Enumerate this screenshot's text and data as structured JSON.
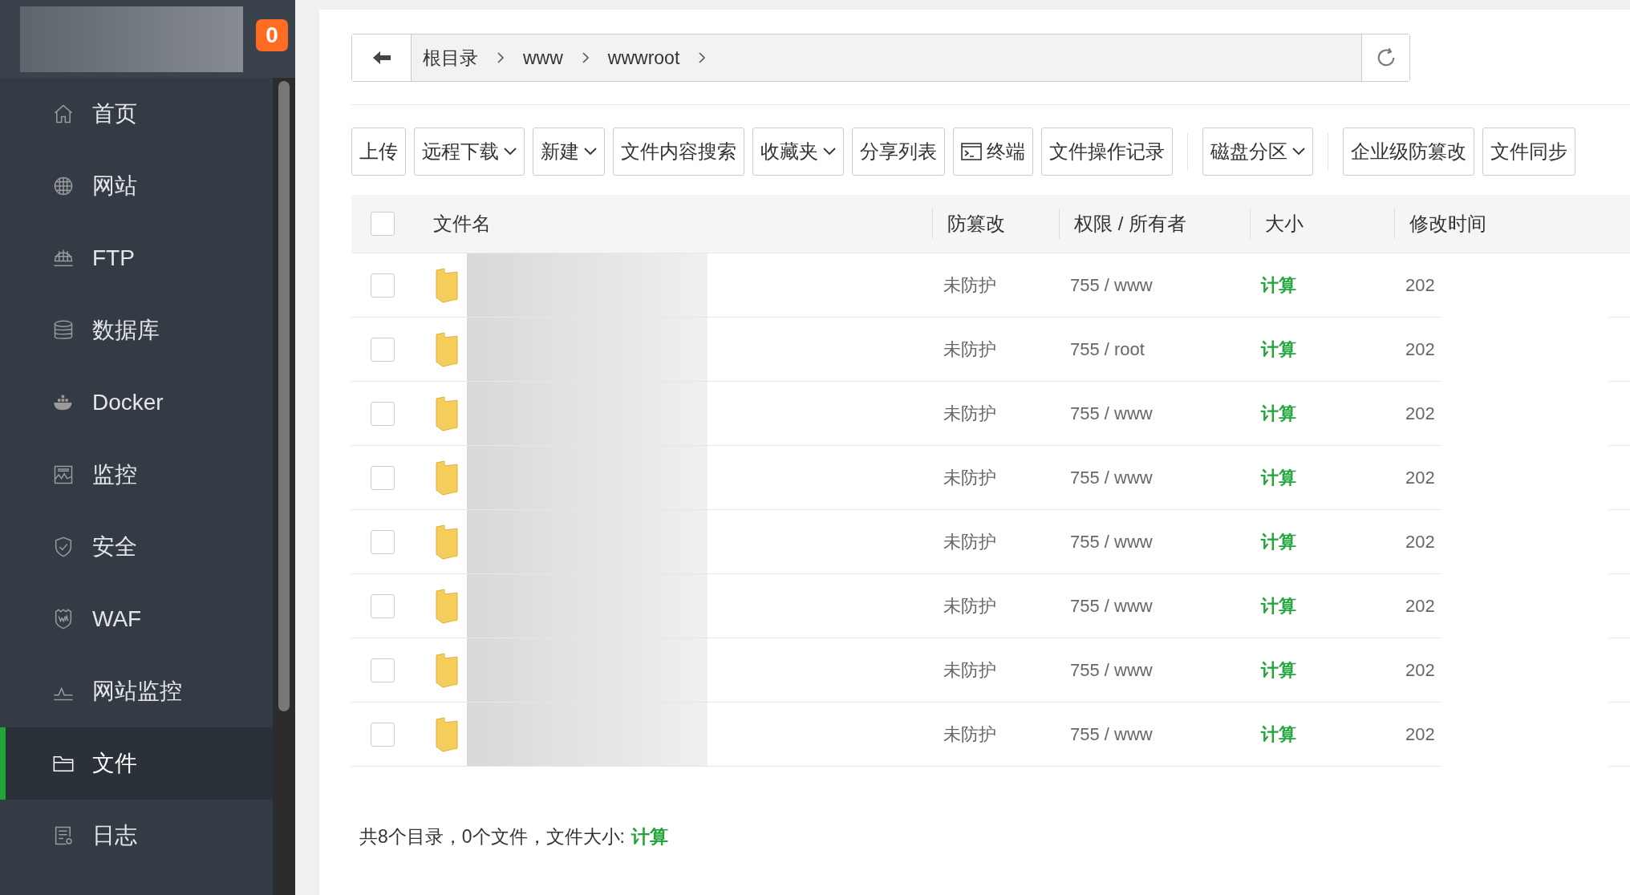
{
  "sidebar": {
    "badge": "0",
    "items": [
      {
        "label": "首页",
        "selected": false
      },
      {
        "label": "网站",
        "selected": false
      },
      {
        "label": "FTP",
        "selected": false
      },
      {
        "label": "数据库",
        "selected": false
      },
      {
        "label": "Docker",
        "selected": false
      },
      {
        "label": "监控",
        "selected": false
      },
      {
        "label": "安全",
        "selected": false
      },
      {
        "label": "WAF",
        "selected": false
      },
      {
        "label": "网站监控",
        "selected": false
      },
      {
        "label": "文件",
        "selected": true
      },
      {
        "label": "日志",
        "selected": false
      }
    ]
  },
  "path": {
    "crumbs": [
      "根目录",
      "www",
      "wwwroot"
    ]
  },
  "toolbar": [
    {
      "label": "上传",
      "dropdown": false,
      "kind": "plain"
    },
    {
      "label": "远程下载",
      "dropdown": true,
      "kind": "plain"
    },
    {
      "label": "新建",
      "dropdown": true,
      "kind": "plain"
    },
    {
      "label": "文件内容搜索",
      "dropdown": false,
      "kind": "plain"
    },
    {
      "label": "收藏夹",
      "dropdown": true,
      "kind": "plain"
    },
    {
      "label": "分享列表",
      "dropdown": false,
      "kind": "plain"
    },
    {
      "label": "终端",
      "dropdown": false,
      "kind": "terminal"
    },
    {
      "label": "文件操作记录",
      "dropdown": false,
      "kind": "plain"
    },
    {
      "label": "磁盘分区",
      "dropdown": true,
      "kind": "plain"
    },
    {
      "label": "企业级防篡改",
      "dropdown": false,
      "kind": "plain"
    },
    {
      "label": "文件同步",
      "dropdown": false,
      "kind": "plain"
    }
  ],
  "table": {
    "select_all": {
      "checked": false
    },
    "columns": [
      "文件名",
      "防篡改",
      "权限 / 所有者",
      "大小",
      "修改时间"
    ],
    "rows": [
      {
        "checked": false,
        "protect": "未防护",
        "perm": "755 / www",
        "size": "计算",
        "modified": "202"
      },
      {
        "checked": false,
        "protect": "未防护",
        "perm": "755 / root",
        "size": "计算",
        "modified": "202"
      },
      {
        "checked": false,
        "protect": "未防护",
        "perm": "755 / www",
        "size": "计算",
        "modified": "202"
      },
      {
        "checked": false,
        "protect": "未防护",
        "perm": "755 / www",
        "size": "计算",
        "modified": "202"
      },
      {
        "checked": false,
        "protect": "未防护",
        "perm": "755 / www",
        "size": "计算",
        "modified": "202"
      },
      {
        "checked": false,
        "protect": "未防护",
        "perm": "755 / www",
        "size": "计算",
        "modified": "202"
      },
      {
        "checked": false,
        "protect": "未防护",
        "perm": "755 / www",
        "size": "计算",
        "modified": "202"
      },
      {
        "checked": false,
        "protect": "未防护",
        "perm": "755 / www",
        "size": "计算",
        "modified": "202"
      }
    ]
  },
  "footer": {
    "summary": "共8个目录，0个文件，文件大小:",
    "link": "计算"
  }
}
